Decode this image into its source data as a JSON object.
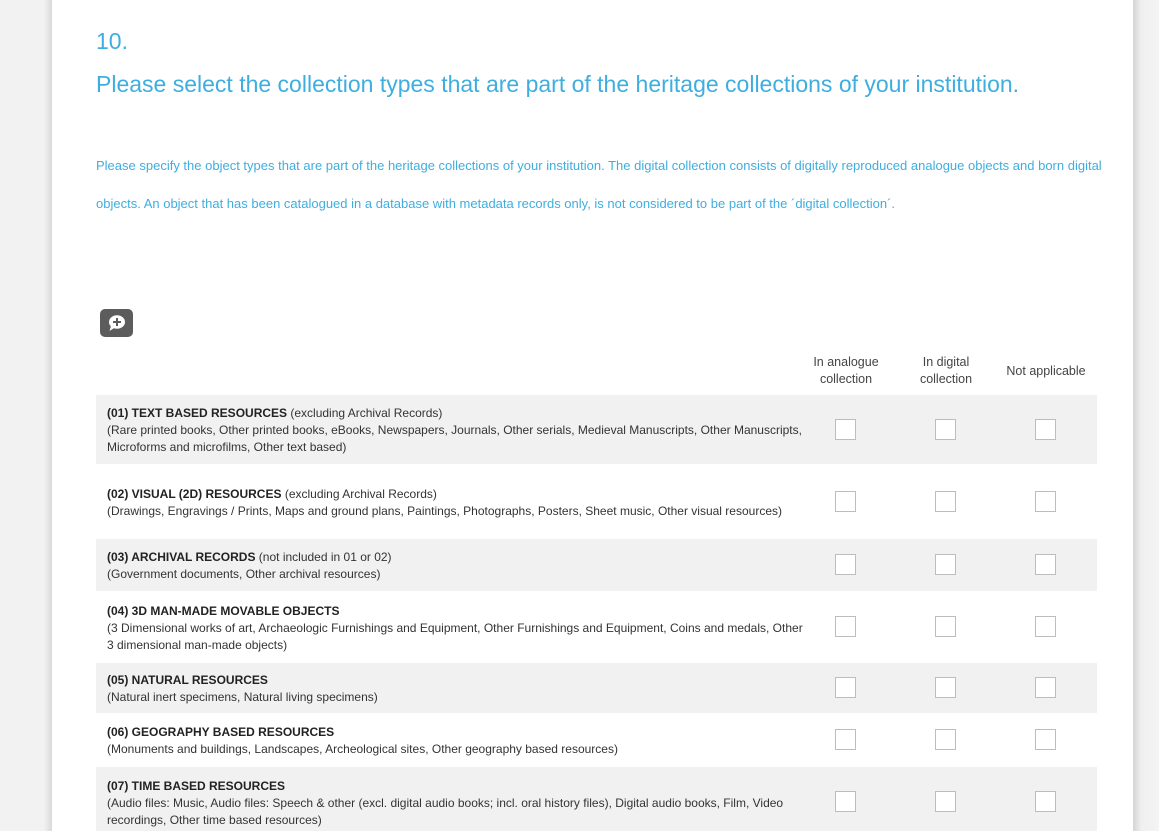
{
  "question": {
    "number": "10.",
    "title": "Please select the collection types that are part of the heritage collections of your institution.",
    "help": "Please specify the object types that are part of the heritage collections of your institution. The digital collection consists of digitally reproduced analogue objects and born digital objects. An object that has been catalogued in a database with metadata records only, is not considered to be part of the ´digital collection´."
  },
  "comment_button": {
    "icon": "comment-add-icon"
  },
  "columns": [
    {
      "label": "In analogue collection"
    },
    {
      "label": "In digital collection"
    },
    {
      "label": "Not applicable"
    }
  ],
  "rows": [
    {
      "title": "(01) TEXT BASED RESOURCES",
      "qualifier": " (excluding Archival Records)",
      "details": "(Rare printed books, Other printed books, eBooks, Newspapers, Journals, Other serials, Medieval Manuscripts, Other Manuscripts, Microforms and microfilms, Other text based)"
    },
    {
      "title": "(02)  VISUAL (2D) RESOURCES",
      "qualifier": " (excluding Archival Records)",
      "details": "(Drawings, Engravings / Prints, Maps and ground plans, Paintings, Photographs, Posters, Sheet music, Other visual resources)"
    },
    {
      "title": "(03) ARCHIVAL RECORDS",
      "qualifier": " (not included in 01 or 02)",
      "details": "(Government documents, Other archival resources)"
    },
    {
      "title": "(04) 3D MAN-MADE MOVABLE OBJECTS",
      "qualifier": "",
      "details": "(3 Dimensional works of art, Archaeologic Furnishings and Equipment, Other Furnishings and Equipment, Coins and medals, Other 3 dimensional man-made objects)"
    },
    {
      "title": "(05) NATURAL RESOURCES",
      "qualifier": "",
      "details": "(Natural inert specimens, Natural living specimens)"
    },
    {
      "title": "(06) GEOGRAPHY BASED RESOURCES",
      "qualifier": "",
      "details": "(Monuments and buildings, Landscapes, Archeological sites, Other geography based resources)"
    },
    {
      "title": "(07) TIME BASED RESOURCES",
      "qualifier": "",
      "details": "(Audio files: Music, Audio files: Speech & other (excl. digital audio books; incl. oral history files), Digital audio books, Film, Video recordings, Other time based resources)"
    }
  ],
  "colors": {
    "accent": "#3eaee0",
    "row_stripe": "#f1f1f1",
    "button": "#5c5c5c"
  }
}
